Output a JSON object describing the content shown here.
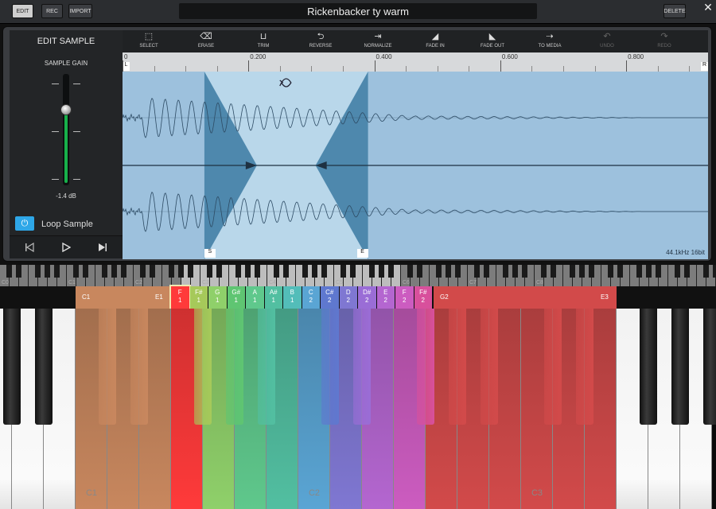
{
  "header": {
    "edit_label": "EDIT",
    "rec_label": "REC",
    "import_label": "IMPORT",
    "title": "Rickenbacker ty warm",
    "delete_label": "DELETE",
    "close_icon": "close-icon"
  },
  "left_panel": {
    "title": "EDIT SAMPLE",
    "gain_label": "SAMPLE GAIN",
    "gain_value": "-1.4 dB",
    "gain_level": 0.68,
    "loop_label": "Loop Sample",
    "loop_on": true,
    "loop_icon": "power-icon",
    "transport": {
      "prev_icon": "skip-back-icon",
      "play_icon": "play-icon",
      "next_icon": "skip-forward-icon"
    }
  },
  "toolbar": {
    "tools": [
      {
        "label": "SELECT",
        "icon": "select-icon",
        "enabled": true
      },
      {
        "label": "ERASE",
        "icon": "eraser-icon",
        "enabled": true
      },
      {
        "label": "TRIM",
        "icon": "trim-icon",
        "enabled": true
      },
      {
        "label": "REVERSE",
        "icon": "reverse-icon",
        "enabled": true
      },
      {
        "label": "NORMALIZE",
        "icon": "normalize-icon",
        "enabled": true
      },
      {
        "label": "FADE IN",
        "icon": "fade-in-icon",
        "enabled": true
      },
      {
        "label": "FADE OUT",
        "icon": "fade-out-icon",
        "enabled": true
      },
      {
        "label": "TO MEDIA",
        "icon": "to-media-icon",
        "enabled": true
      },
      {
        "label": "UNDO",
        "icon": "undo-icon",
        "enabled": false
      },
      {
        "label": "REDO",
        "icon": "redo-icon",
        "enabled": false
      }
    ]
  },
  "ruler": {
    "labels": [
      "0",
      "0.200",
      "0.400",
      "0.600",
      "0.800"
    ],
    "left_marker": "L",
    "right_marker": "R"
  },
  "waveform": {
    "sample_rate": "44.1kHz 16bit",
    "start_marker": "S",
    "end_marker": "E",
    "loop_icon": "loop-icon",
    "duration_s": 0.93,
    "loop_start_s": 0.13,
    "loop_end_s": 0.39,
    "wave_color": "#2d4b64",
    "bg_color": "#9dc1dd",
    "loop_region_color": "#b9d7ea",
    "crossfade_color": "#4e88ad"
  },
  "mini_keyboard": {
    "octave_labels": [
      "C0",
      "C1",
      "C2",
      "C3",
      "C4",
      "C5",
      "C6",
      "C7",
      "C8"
    ]
  },
  "zones": [
    {
      "note": "F",
      "oct": "1",
      "color": "#ff3a3a",
      "selected": true
    },
    {
      "note": "F#",
      "oct": "1",
      "color": "#a6c95a"
    },
    {
      "note": "G",
      "oct": "1",
      "color": "#8fd06a"
    },
    {
      "note": "G#",
      "oct": "1",
      "color": "#5fc572"
    },
    {
      "note": "A",
      "oct": "1",
      "color": "#5fc88c"
    },
    {
      "note": "A#",
      "oct": "1",
      "color": "#52bfa1"
    },
    {
      "note": "B",
      "oct": "1",
      "color": "#53bdb9"
    },
    {
      "note": "C",
      "oct": "2",
      "color": "#5aa5d4"
    },
    {
      "note": "C#",
      "oct": "2",
      "color": "#5f78cf"
    },
    {
      "note": "D",
      "oct": "2",
      "color": "#7f77d2"
    },
    {
      "note": "D#",
      "oct": "2",
      "color": "#9a6dd6"
    },
    {
      "note": "E",
      "oct": "2",
      "color": "#b466d0"
    },
    {
      "note": "F",
      "oct": "2",
      "color": "#cc5cc0"
    },
    {
      "note": "F#",
      "oct": "2",
      "color": "#d8509c"
    }
  ],
  "range_left": {
    "start": "C1",
    "end": "E1",
    "color": "#c8875e"
  },
  "range_right": {
    "start": "G2",
    "end": "E3",
    "color": "#d24a4a"
  },
  "keyboard": {
    "labels": [
      "C1",
      "C2",
      "C3"
    ]
  }
}
